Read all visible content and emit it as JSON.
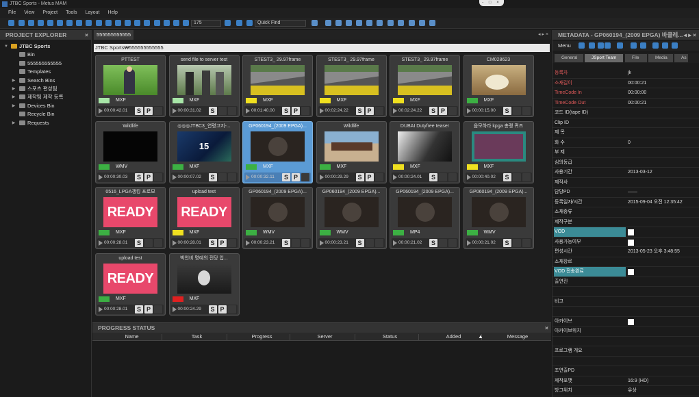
{
  "app_title": "JTBC Sports - Metus MAM",
  "window_controls": "- □ ×",
  "menu": [
    "File",
    "View",
    "Project",
    "Tools",
    "Layout",
    "Help"
  ],
  "toolbar": {
    "zoom_value": "175",
    "quick_find_label": "Quick Find"
  },
  "explorer": {
    "title": "PROJECT EXPLORER",
    "close": "×",
    "items": [
      {
        "label": "JTBC Sports",
        "level": 0,
        "expander": "▼"
      },
      {
        "label": "Bin",
        "level": 1,
        "expander": ""
      },
      {
        "label": "555555555555",
        "level": 1,
        "expander": ""
      },
      {
        "label": "Templates",
        "level": 1,
        "expander": ""
      },
      {
        "label": "Search Bins",
        "level": 1,
        "expander": "▶"
      },
      {
        "label": "스포츠 편성팀",
        "level": 1,
        "expander": "▶"
      },
      {
        "label": "제작팀 제작 등록",
        "level": 1,
        "expander": "▶"
      },
      {
        "label": "Devices Bin",
        "level": 1,
        "expander": "▶"
      },
      {
        "label": "Recycle Bin",
        "level": 1,
        "expander": ""
      },
      {
        "label": "Requests",
        "level": 1,
        "expander": "▶"
      }
    ]
  },
  "center": {
    "tab": "555555555555",
    "tab_nav": "◂ ▸ ×",
    "path": "JTBC Sports₩555555555555",
    "cards": [
      {
        "title": "PTTEST",
        "format": "MXF",
        "timecode": "00:00:42.01",
        "tag": "#a8e6a8",
        "thumb": "golf",
        "buttons": "SP"
      },
      {
        "title": "send file  to server test",
        "format": "MXF",
        "timecode": "00:00:31.02",
        "tag": "#a8e6a8",
        "thumb": "golfers",
        "buttons": "S"
      },
      {
        "title": "STEST3_ 29.97frame",
        "format": "MXF",
        "timecode": "00:01:40.00",
        "tag": "#f0e020",
        "thumb": "race",
        "buttons": "SP"
      },
      {
        "title": "STEST3_ 29.97frame",
        "format": "MXF",
        "timecode": "00:02:24.22",
        "tag": "#f0e020",
        "thumb": "race",
        "buttons": "SP"
      },
      {
        "title": "STEST3_ 29.97frame",
        "format": "MXF",
        "timecode": "00:02:24.22",
        "tag": "#f0e020",
        "thumb": "race",
        "buttons": "SP"
      },
      {
        "title": "CM028623",
        "format": "MXF",
        "timecode": "00:00:15.00",
        "tag": "#3cb043",
        "thumb": "food",
        "buttons": "S"
      },
      {
        "title": "Wildlife",
        "format": "WMV",
        "timecode": "00:00:30.03",
        "tag": "#3cb043",
        "thumb": "black",
        "buttons": "SP"
      },
      {
        "title": "◎◎◎JTBC3_연령고지-...",
        "format": "MXF",
        "timecode": "00:00:07.02",
        "tag": "#3cb043",
        "thumb": "fifteen",
        "buttons": "S"
      },
      {
        "title": "GP060194_(2009 EPGA)...",
        "format": "MXF",
        "timecode": "00:00:32.11",
        "tag": "#3cb043",
        "thumb": "dark",
        "buttons": "SP",
        "selected": true
      },
      {
        "title": "Wildlife",
        "format": "MXF",
        "timecode": "00:00:29.29",
        "tag": "#3cb043",
        "thumb": "horses",
        "buttons": "SP"
      },
      {
        "title": "DUBAI Dutyfree teaser",
        "format": "MXF",
        "timecode": "00:00:24.01",
        "tag": "#f0e020",
        "thumb": "bw",
        "buttons": "S"
      },
      {
        "title": "음모하라 kpga 총랭 퀴즈",
        "format": "MXF",
        "timecode": "00:00:40.02",
        "tag": "#f0e020",
        "thumb": "green",
        "buttons": "S"
      },
      {
        "title": "0516_LPGA갱킹 프로모",
        "format": "MXF",
        "timecode": "00:00:28.01",
        "tag": "#3cb043",
        "thumb": "ready",
        "buttons": "S"
      },
      {
        "title": "upload test",
        "format": "MXF",
        "timecode": "00:00:28.01",
        "tag": "#f0e020",
        "thumb": "ready",
        "buttons": "SP"
      },
      {
        "title": "GP060194_(2009 EPGA)...",
        "format": "WMV",
        "timecode": "00:00:23.21",
        "tag": "#3cb043",
        "thumb": "dark",
        "buttons": "S"
      },
      {
        "title": "GP060194_(2009 EPGA)...",
        "format": "WMV",
        "timecode": "00:00:23.21",
        "tag": "#3cb043",
        "thumb": "dark",
        "buttons": "S"
      },
      {
        "title": "GP060194_(2009 EPGA)...",
        "format": "MP4",
        "timecode": "00:00:21.02",
        "tag": "#3cb043",
        "thumb": "dark",
        "buttons": "S"
      },
      {
        "title": "GP060194_(2009 EPGA)...",
        "format": "WMV",
        "timecode": "00:00:21.02",
        "tag": "#3cb043",
        "thumb": "dark",
        "buttons": "S"
      },
      {
        "title": "upload test",
        "format": "MXF",
        "timecode": "00:00:28.01",
        "tag": "#3cb043",
        "thumb": "ready",
        "buttons": "SP"
      },
      {
        "title": "박인비 명예의 전당 입...",
        "format": "MXF",
        "timecode": "00:00:24.29",
        "tag": "#e02020",
        "thumb": "hall",
        "buttons": "SP"
      }
    ],
    "ready_text": "READY",
    "fifteen_text": "15"
  },
  "progress": {
    "title": "PROGRESS STATUS",
    "close": "×",
    "columns": [
      "Name",
      "Task",
      "Progress",
      "Server",
      "Status",
      "Added",
      "Message"
    ],
    "sort_indicator": "▲"
  },
  "metadata": {
    "title": "METADATA - GP060194_(2009 EPGA) 바클레...",
    "nav": "◂ ▸ ×",
    "menu_label": "Menu",
    "tabs": [
      "General",
      "JSport Team",
      "File",
      "Media",
      "As"
    ],
    "rows": [
      {
        "key": "등록자",
        "value": "jk",
        "style": "red"
      },
      {
        "key": "소재길이",
        "value": "00:00:21",
        "style": "red"
      },
      {
        "key": "TimeCode In",
        "value": "00:00:00",
        "style": "red"
      },
      {
        "key": "TimeCode Out",
        "value": "00:00:21",
        "style": "red"
      },
      {
        "key": "코드 ID(tape ID)",
        "value": ""
      },
      {
        "key": "Clip ID",
        "value": ""
      },
      {
        "key": "제   목",
        "value": ""
      },
      {
        "key": "화   수",
        "value": "0"
      },
      {
        "key": "부   제",
        "value": ""
      },
      {
        "key": "심의등급",
        "value": ""
      },
      {
        "key": "사용기간",
        "value": "2013-03-12"
      },
      {
        "key": "제작사",
        "value": ""
      },
      {
        "key": "담당PD",
        "value": "——"
      },
      {
        "key": "등록일자/시간",
        "value": "2015-09-04 오전 12:35:42"
      },
      {
        "key": "소재종류",
        "value": ""
      },
      {
        "key": "제작구분",
        "value": ""
      },
      {
        "key": "VOD",
        "value": "",
        "style": "hl",
        "checkbox": true
      },
      {
        "key": "사용가능여부",
        "value": "",
        "checkbox": true
      },
      {
        "key": "편성시간",
        "value": "2013-05-23 오후 3:48:55"
      },
      {
        "key": "소재장르",
        "value": ""
      },
      {
        "key": "VOD 전송완료",
        "value": "",
        "style": "hl",
        "checkbox": true
      },
      {
        "key": "출연진",
        "value": ""
      },
      {
        "key": "",
        "value": ""
      },
      {
        "key": "비고",
        "value": ""
      },
      {
        "key": "",
        "value": ""
      },
      {
        "key": "아카이브",
        "value": "",
        "checkbox": true
      },
      {
        "key": "아카이브위치",
        "value": ""
      },
      {
        "key": "",
        "value": ""
      },
      {
        "key": "프로그램 개요",
        "value": ""
      },
      {
        "key": "",
        "value": ""
      },
      {
        "key": "조연출PD",
        "value": ""
      },
      {
        "key": "제작포맷",
        "value": "16:9 (HD)"
      },
      {
        "key": "방그위치",
        "value": "유상"
      }
    ]
  },
  "colors": {
    "accent": "#3b7fc4",
    "selected": "#5b9bd5",
    "vod_highlight": "#3b8b96",
    "red_label": "#e05a5a"
  }
}
